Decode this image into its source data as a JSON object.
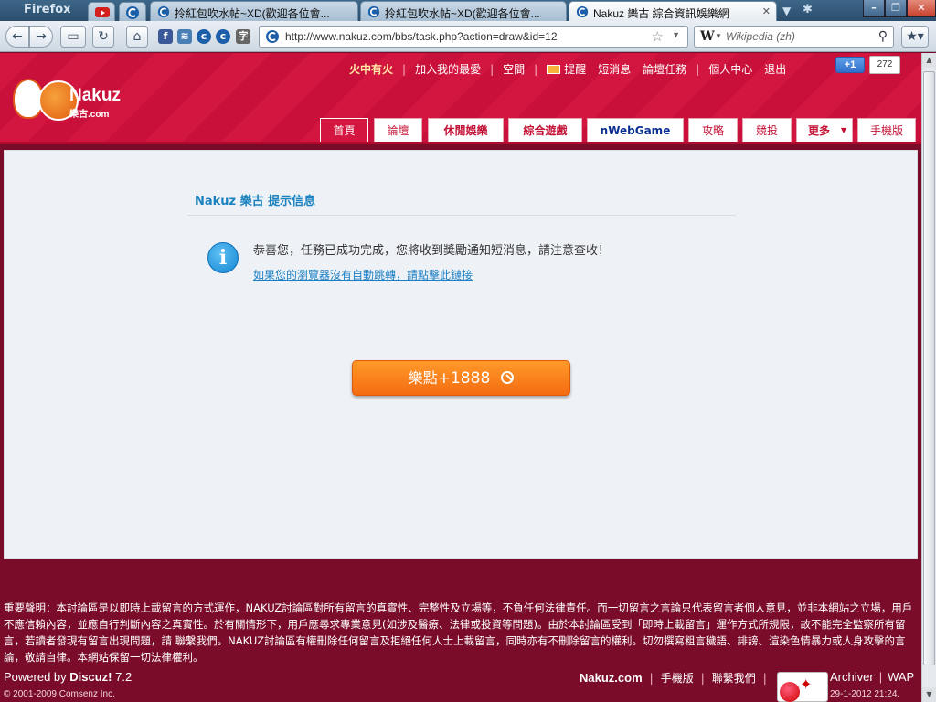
{
  "browser": {
    "app_name": "Firefox",
    "tabs": [
      {
        "title": "拎紅包吹水帖~XD(歡迎各位會..."
      },
      {
        "title": "拎紅包吹水帖~XD(歡迎各位會..."
      },
      {
        "title": "Nakuz 樂古 綜合資訊娛樂網"
      }
    ],
    "url": "http://www.nakuz.com/bbs/task.php?action=draw&id=12",
    "search_placeholder": "Wikipedia (zh)",
    "search_engine_letter": "W"
  },
  "site": {
    "logo_name": "Nakuz",
    "logo_sub": "樂古.com",
    "top_links": [
      "火中有火",
      "加入我的最愛",
      "空間",
      "提醒",
      "短消息",
      "論壇任務",
      "個人中心",
      "退出"
    ],
    "gplus_label": "+1",
    "gplus_count": "272",
    "nav_tabs": [
      "首頁",
      "論壇",
      "休閒娛樂",
      "綜合遊戲",
      "nWebGame",
      "攻略",
      "競投",
      "更多",
      "手機版"
    ]
  },
  "message": {
    "title": "Nakuz 樂古 提示信息",
    "text": "恭喜您，任務已成功完成，您將收到獎勵通知短消息，請注意查收！",
    "link": "如果您的瀏覽器沒有自動跳轉，請點擊此鏈接",
    "reward_label": "樂點",
    "reward_value": "+1888"
  },
  "footer": {
    "disclaimer": "重要聲明：本討論區是以即時上載留言的方式運作，NAKUZ討論區對所有留言的真實性、完整性及立場等，不負任何法律責任。而一切留言之言論只代表留言者個人意見，並非本網站之立場，用戶不應信賴內容，並應自行判斷內容之真實性。於有關情形下，用戶應尋求專業意見(如涉及醫療、法律或投資等問題)。由於本討論區受到「即時上載留言」運作方式所規限，故不能完全監察所有留言，若讀者發現有留言出現問題，請 聯繫我們。NAKUZ討論區有權刪除任何留言及拒絕任何人士上載留言，同時亦有不刪除留言的權利。切勿撰寫粗言穢語、誹謗、渲染色情暴力或人身攻擊的言論，敬請自律。本網站保留一切法律權利。",
    "powered_prefix": "Powered by",
    "powered_brand": "Discuz!",
    "powered_version": "7.2",
    "copyright": "© 2001-2009 Comsenz Inc.",
    "links": [
      "Nakuz.com",
      "手機版",
      "聯繫我們"
    ],
    "right_links": [
      "Archiver",
      "WAP"
    ],
    "date": "29-1-2012 21:24."
  }
}
